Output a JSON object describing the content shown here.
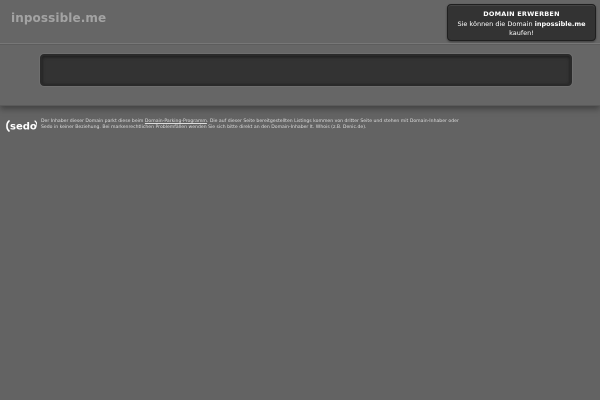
{
  "header": {
    "domain_title": "inpossible.me"
  },
  "buy_box": {
    "title": "DOMAIN ERWERBEN",
    "desc_prefix": "Sie können die Domain ",
    "desc_domain": "inpossible.me",
    "desc_suffix": "kaufen!"
  },
  "search": {
    "placeholder": ""
  },
  "footer": {
    "logo_text": "sedo",
    "text_part1": "Der Inhaber dieser Domain parkt diese beim ",
    "link_text": "Domain-Parking-Programm",
    "text_part2": ". Die auf dieser Seite bereitgestellten Listings kommen von dritter Seite und stehen mit Domain-Inhaber oder Sedo in keiner Beziehung. Bei markenrechtlichen Problemfällen wenden Sie sich bitte direkt an den Domain-Inhaber lt. Whois (z.B. Denic.de)."
  },
  "colors": {
    "background": "#636363",
    "box": "#333333",
    "text_light": "#dddddd"
  }
}
